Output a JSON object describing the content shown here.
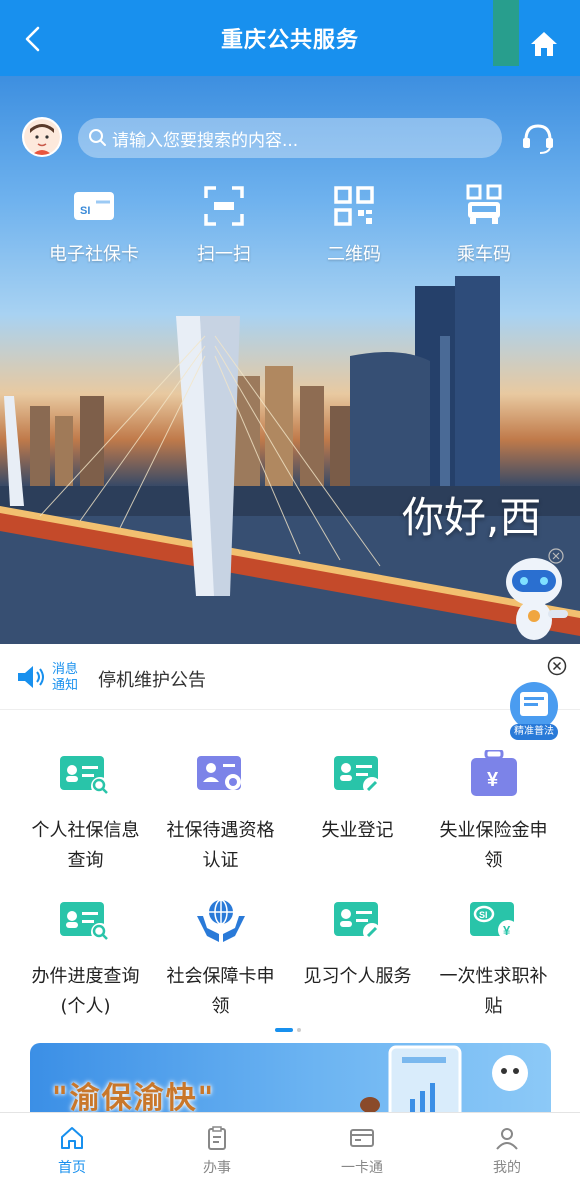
{
  "header": {
    "title": "重庆公共服务",
    "accent": "#1890ee"
  },
  "hero": {
    "search_placeholder": "请输入您要搜索的内容...",
    "quick_actions": [
      {
        "label": "电子社保卡",
        "icon": "social-card-icon"
      },
      {
        "label": "扫一扫",
        "icon": "scan-icon"
      },
      {
        "label": "二维码",
        "icon": "qr-code-icon"
      },
      {
        "label": "乘车码",
        "icon": "bus-code-icon"
      }
    ],
    "greeting": "你好,西"
  },
  "notice": {
    "tag_line1": "消息",
    "tag_line2": "通知",
    "text": "停机维护公告",
    "law_badge": "精准普法"
  },
  "services": [
    {
      "label": "个人社保信息查询",
      "icon": "id-card-search-icon"
    },
    {
      "label": "社保待遇资格认证",
      "icon": "certification-icon"
    },
    {
      "label": "失业登记",
      "icon": "register-icon"
    },
    {
      "label": "失业保险金申领",
      "icon": "money-bag-icon"
    },
    {
      "label": "办件进度查询(个人)",
      "icon": "progress-search-icon"
    },
    {
      "label": "社会保障卡申领",
      "icon": "globe-hands-icon"
    },
    {
      "label": "见习个人服务",
      "icon": "intern-icon"
    },
    {
      "label": "一次性求职补贴",
      "icon": "subsidy-icon"
    }
  ],
  "banner": {
    "text": "\"渝保渝快\""
  },
  "nav": [
    {
      "label": "首页",
      "icon": "home-icon",
      "active": true
    },
    {
      "label": "办事",
      "icon": "clipboard-icon",
      "active": false
    },
    {
      "label": "一卡通",
      "icon": "card-icon",
      "active": false
    },
    {
      "label": "我的",
      "icon": "user-icon",
      "active": false
    }
  ]
}
